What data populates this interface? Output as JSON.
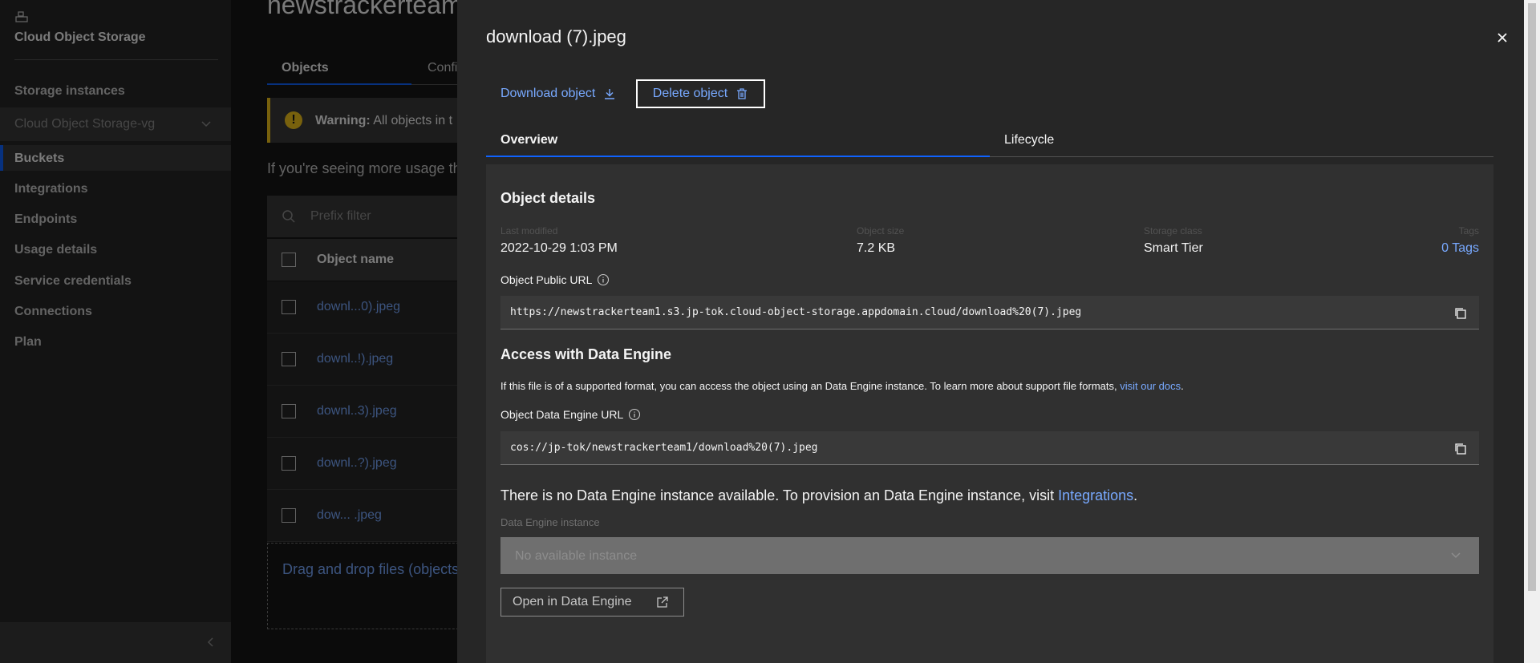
{
  "sidebar": {
    "title": "Cloud Object Storage",
    "storage_instances": "Storage instances",
    "instance_select": "Cloud Object Storage-vg",
    "items": [
      {
        "label": "Buckets"
      },
      {
        "label": "Integrations"
      },
      {
        "label": "Endpoints"
      },
      {
        "label": "Usage details"
      },
      {
        "label": "Service credentials"
      },
      {
        "label": "Connections"
      },
      {
        "label": "Plan"
      }
    ]
  },
  "mainpage": {
    "title": "newstrackerteam",
    "tabs": [
      "Objects",
      "Confi"
    ],
    "warning_label": "Warning:",
    "warning_text": " All objects in t",
    "usage_text": "If you're seeing more usage th",
    "filter_placeholder": "Prefix filter",
    "column_header": "Object name",
    "rows": [
      "downl...0).jpeg",
      "downl..!).jpeg",
      "downl..3).jpeg",
      "downl..?).jpeg",
      "dow... .jpeg"
    ],
    "drop_text": "Drag and drop files (objects"
  },
  "panel": {
    "title": "download (7).jpeg",
    "download_label": "Download object",
    "delete_label": "Delete object",
    "tabs": {
      "overview": "Overview",
      "lifecycle": "Lifecycle"
    },
    "object_details": {
      "title": "Object details",
      "last_modified_label": "Last modified",
      "last_modified": "2022-10-29 1:03 PM",
      "size_label": "Object size",
      "size": "7.2 KB",
      "storage_class_label": "Storage class",
      "storage_class": "Smart Tier",
      "tags_label": "Tags",
      "tags": "0 Tags"
    },
    "public_url_label": "Object Public URL",
    "public_url": "https://newstrackerteam1.s3.jp-tok.cloud-object-storage.appdomain.cloud/download%20(7).jpeg",
    "data_engine": {
      "title": "Access with Data Engine",
      "description": "If this file is of a supported format, you can access the object using an Data Engine instance. To learn more about support file formats, ",
      "docs_link": "visit our docs",
      "description_end": ".",
      "url_label": "Object Data Engine URL",
      "url": "cos://jp-tok/newstrackerteam1/download%20(7).jpeg",
      "no_instance_text": "There is no Data Engine instance available. To provision an Data Engine instance, visit ",
      "integrations_link": "Integrations",
      "no_instance_end": ".",
      "instance_label": "Data Engine instance",
      "instance_placeholder": "No available instance",
      "open_button": "Open in Data Engine"
    }
  },
  "colors": {
    "accent": "#0f62fe",
    "link": "#78a9ff",
    "warning": "#f1c21b"
  }
}
